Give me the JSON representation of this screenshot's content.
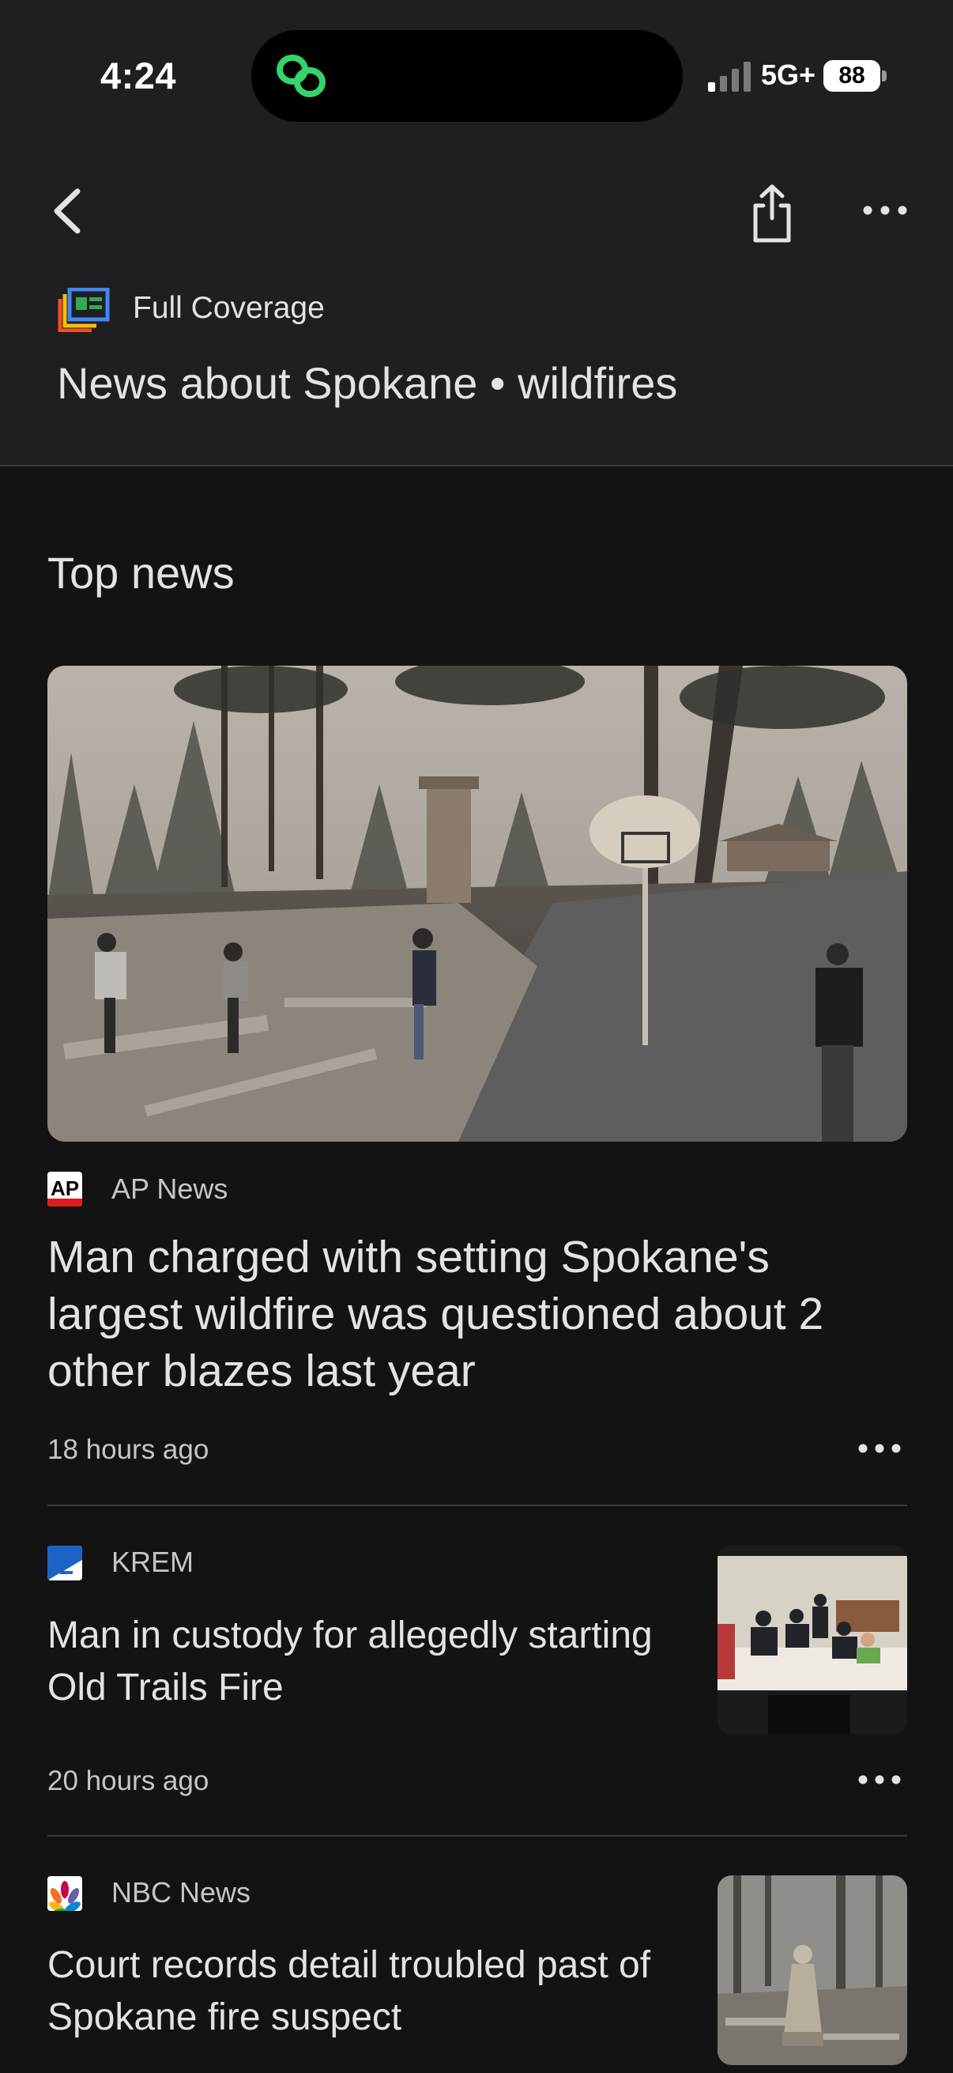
{
  "status_bar": {
    "time": "4:24",
    "network": "5G+",
    "battery": "88"
  },
  "header": {
    "section_label": "Full Coverage",
    "topic_title": "News about Spokane • wildfires"
  },
  "main": {
    "section_heading": "Top news",
    "articles": [
      {
        "source": "AP News",
        "source_logo_text": "AP",
        "headline": "Man charged with setting Spokane's largest wildfire was questioned about 2 other blazes last year",
        "time": "18 hours ago"
      },
      {
        "source": "KREM",
        "source_logo_text": "2",
        "headline": "Man in custody for allegedly starting Old Trails Fire",
        "time": "20 hours ago"
      },
      {
        "source": "NBC News",
        "headline": "Court records detail troubled past of Spokane fire suspect"
      }
    ]
  },
  "colors": {
    "background": "#131314",
    "header_background": "#1f1f21",
    "text_primary": "#e3e3e3",
    "text_secondary": "#c4c7c5",
    "divider": "#3c3c3f"
  }
}
